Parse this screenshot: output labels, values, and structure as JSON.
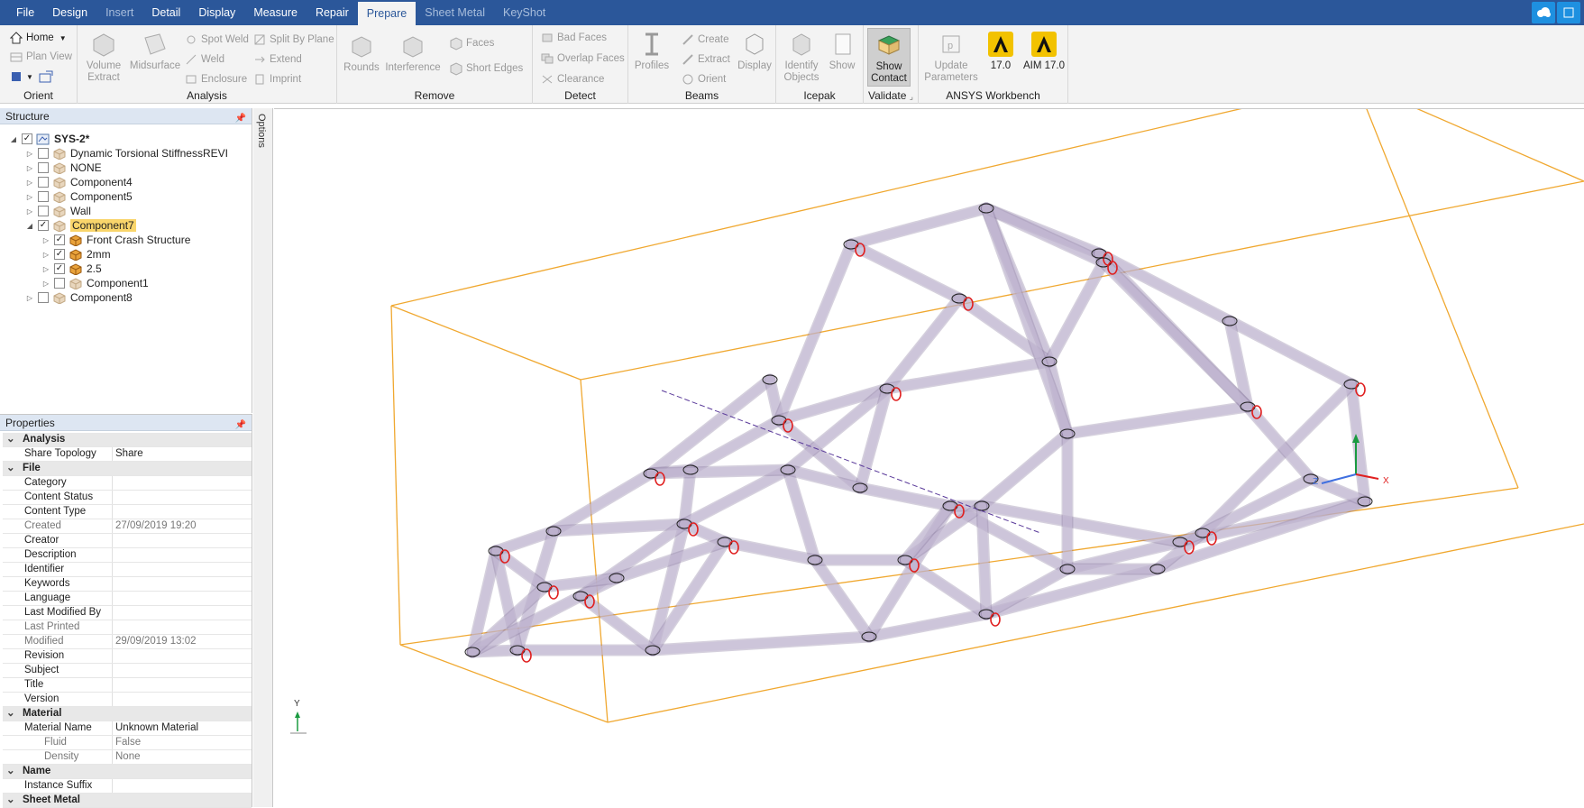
{
  "menu": {
    "tabs": [
      {
        "label": "File",
        "state": "normal"
      },
      {
        "label": "Design",
        "state": "normal"
      },
      {
        "label": "Insert",
        "state": "dim"
      },
      {
        "label": "Detail",
        "state": "normal"
      },
      {
        "label": "Display",
        "state": "normal"
      },
      {
        "label": "Measure",
        "state": "normal"
      },
      {
        "label": "Repair",
        "state": "normal"
      },
      {
        "label": "Prepare",
        "state": "active"
      },
      {
        "label": "Sheet Metal",
        "state": "dim"
      },
      {
        "label": "KeyShot",
        "state": "dim"
      }
    ],
    "corner_icons": [
      "cloud-icon",
      "app-icon"
    ]
  },
  "ribbon": {
    "orient": {
      "label": "Orient",
      "home": "Home",
      "plan_view": "Plan View"
    },
    "analysis": {
      "label": "Analysis",
      "volume_extract": "Volume Extract",
      "midsurface": "Midsurface",
      "spot_weld": "Spot Weld",
      "weld": "Weld",
      "enclosure": "Enclosure",
      "split_by_plane": "Split By Plane",
      "extend": "Extend",
      "imprint": "Imprint"
    },
    "remove": {
      "label": "Remove",
      "rounds": "Rounds",
      "interference": "Interference",
      "faces": "Faces",
      "short_edges": "Short Edges"
    },
    "detect": {
      "label": "Detect",
      "bad_faces": "Bad Faces",
      "overlap_faces": "Overlap Faces",
      "clearance": "Clearance"
    },
    "beams": {
      "label": "Beams",
      "profiles": "Profiles",
      "create": "Create",
      "extract": "Extract",
      "orient": "Orient",
      "display": "Display"
    },
    "icepak": {
      "label": "Icepak",
      "identify_objects": "Identify Objects",
      "show": "Show"
    },
    "validate": {
      "label": "Validate",
      "show_contact": "Show Contact"
    },
    "workbench": {
      "label": "ANSYS Workbench",
      "update_parameters": "Update Parameters",
      "v17": "17.0",
      "aim17": "AIM 17.0"
    }
  },
  "structure": {
    "title": "Structure",
    "items": [
      {
        "label": "SYS-2*",
        "level": 0,
        "expanded": true,
        "checked": true,
        "bold": true,
        "selected": false,
        "icon": "design-icon"
      },
      {
        "label": "Dynamic Torsional StiffnessREVI",
        "level": 1,
        "expanded": false,
        "checked": false,
        "bold": false,
        "selected": false,
        "icon": "component-icon"
      },
      {
        "label": "NONE",
        "level": 1,
        "expanded": false,
        "checked": false,
        "bold": false,
        "selected": false,
        "icon": "component-icon"
      },
      {
        "label": "Component4",
        "level": 1,
        "expanded": false,
        "checked": false,
        "bold": false,
        "selected": false,
        "icon": "component-icon"
      },
      {
        "label": "Component5",
        "level": 1,
        "expanded": false,
        "checked": false,
        "bold": false,
        "selected": false,
        "icon": "component-icon"
      },
      {
        "label": "Wall",
        "level": 1,
        "expanded": false,
        "checked": false,
        "bold": false,
        "selected": false,
        "icon": "component-icon"
      },
      {
        "label": "Component7",
        "level": 1,
        "expanded": true,
        "checked": true,
        "bold": false,
        "selected": true,
        "icon": "component-icon"
      },
      {
        "label": "Front Crash Structure",
        "level": 2,
        "expanded": false,
        "checked": true,
        "bold": false,
        "selected": false,
        "icon": "component-icon"
      },
      {
        "label": "2mm",
        "level": 2,
        "expanded": false,
        "checked": true,
        "bold": false,
        "selected": false,
        "icon": "component-icon"
      },
      {
        "label": "2.5",
        "level": 2,
        "expanded": false,
        "checked": true,
        "bold": false,
        "selected": false,
        "icon": "component-icon"
      },
      {
        "label": "Component1",
        "level": 2,
        "expanded": false,
        "checked": false,
        "bold": false,
        "selected": false,
        "icon": "component-icon"
      },
      {
        "label": "Component8",
        "level": 1,
        "expanded": false,
        "checked": false,
        "bold": false,
        "selected": false,
        "icon": "component-icon"
      }
    ]
  },
  "options_label": "Options",
  "properties": {
    "title": "Properties",
    "rows": [
      {
        "type": "cat",
        "key": "Analysis"
      },
      {
        "type": "row",
        "key": "Share Topology",
        "value": "Share"
      },
      {
        "type": "cat",
        "key": "File"
      },
      {
        "type": "row",
        "key": "Category",
        "value": ""
      },
      {
        "type": "row",
        "key": "Content Status",
        "value": ""
      },
      {
        "type": "row",
        "key": "Content Type",
        "value": ""
      },
      {
        "type": "dim",
        "key": "Created",
        "value": "27/09/2019 19:20"
      },
      {
        "type": "row",
        "key": "Creator",
        "value": ""
      },
      {
        "type": "row",
        "key": "Description",
        "value": ""
      },
      {
        "type": "row",
        "key": "Identifier",
        "value": ""
      },
      {
        "type": "row",
        "key": "Keywords",
        "value": ""
      },
      {
        "type": "row",
        "key": "Language",
        "value": ""
      },
      {
        "type": "row",
        "key": "Last Modified By",
        "value": ""
      },
      {
        "type": "dim",
        "key": "Last Printed",
        "value": ""
      },
      {
        "type": "dim",
        "key": "Modified",
        "value": "29/09/2019 13:02"
      },
      {
        "type": "row",
        "key": "Revision",
        "value": ""
      },
      {
        "type": "row",
        "key": "Subject",
        "value": ""
      },
      {
        "type": "row",
        "key": "Title",
        "value": ""
      },
      {
        "type": "row",
        "key": "Version",
        "value": ""
      },
      {
        "type": "cat",
        "key": "Material"
      },
      {
        "type": "row",
        "key": "Material Name",
        "value": "Unknown Material"
      },
      {
        "type": "sub",
        "key": "Fluid",
        "value": "False"
      },
      {
        "type": "sub",
        "key": "Density",
        "value": "None"
      },
      {
        "type": "cat",
        "key": "Name"
      },
      {
        "type": "row",
        "key": "Instance Suffix",
        "value": ""
      },
      {
        "type": "cat",
        "key": "Sheet Metal"
      }
    ]
  },
  "viewport": {
    "bbox_color": "#f0a830",
    "tube_color": "#c9bfd9",
    "highlight_color": "#e02020",
    "axis_labels": {
      "z": "Z",
      "x": "X",
      "y": "Y"
    }
  }
}
